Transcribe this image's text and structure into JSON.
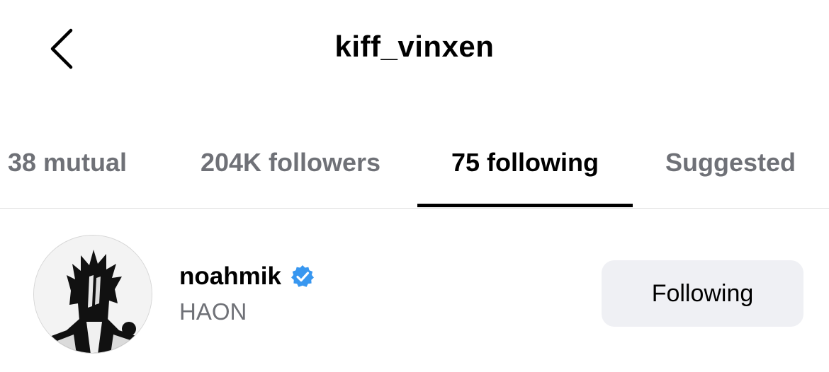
{
  "header": {
    "back_icon": "chevron-left-icon",
    "title": "kiff_vinxen"
  },
  "tabs": [
    {
      "label": "38 mutual",
      "active": false
    },
    {
      "label": "204K followers",
      "active": false
    },
    {
      "label": "75 following",
      "active": true
    },
    {
      "label": "Suggested",
      "active": false
    }
  ],
  "list": {
    "items": [
      {
        "username": "noahmik",
        "verified": true,
        "full_name": "HAON",
        "button_label": "Following",
        "avatar_icon": "profile-avatar"
      }
    ]
  },
  "colors": {
    "primary_text": "#000000",
    "secondary_text": "#6f7177",
    "verified_badge": "#3897f0",
    "button_background": "#eff0f4",
    "divider": "#e2e2e2"
  }
}
